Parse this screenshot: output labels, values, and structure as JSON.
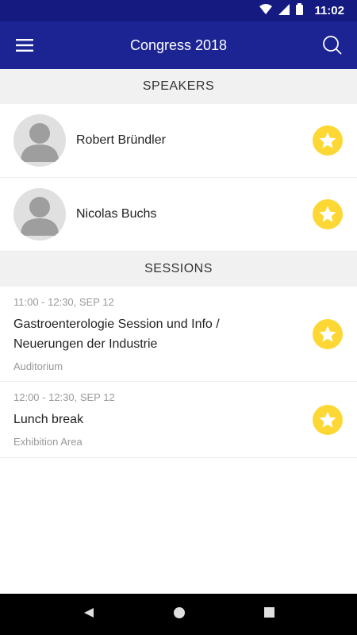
{
  "status_bar": {
    "time": "11:02"
  },
  "app_bar": {
    "title": "Congress 2018"
  },
  "speakers_section": {
    "header": "SPEAKERS",
    "items": [
      {
        "name": "Robert Bründler"
      },
      {
        "name": "Nicolas Buchs"
      }
    ]
  },
  "sessions_section": {
    "header": "SESSIONS",
    "items": [
      {
        "time": "11:00 - 12:30, SEP 12",
        "title_line1": "Gastroenterologie Session und Info /",
        "title_line2": "Neuerungen der Industrie",
        "location": "Auditorium"
      },
      {
        "time": "12:00 - 12:30, SEP 12",
        "title_line1": "Lunch break",
        "title_line2": "",
        "location": "Exhibition Area"
      }
    ]
  },
  "colors": {
    "primary": "#1c2494",
    "status": "#141a80",
    "star": "#fdd835",
    "section_bg": "#f1f1f1"
  },
  "icons": [
    "wifi-icon",
    "signal-icon",
    "battery-icon",
    "menu-icon",
    "search-icon",
    "star-icon",
    "back-icon",
    "home-icon",
    "recents-icon"
  ]
}
